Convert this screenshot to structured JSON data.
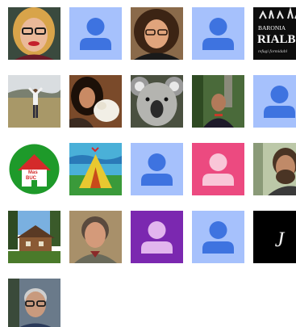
{
  "avatars": [
    {
      "name": "avatar-woman-glasses-red-lips",
      "kind": "photo"
    },
    {
      "name": "avatar-default-blue",
      "kind": "placeholder",
      "colors": {
        "bg": "#a6c1fc",
        "fg": "#3e73e0"
      }
    },
    {
      "name": "avatar-woman-curly-hair",
      "kind": "photo"
    },
    {
      "name": "avatar-default-blue",
      "kind": "placeholder",
      "colors": {
        "bg": "#a6c1fc",
        "fg": "#3e73e0"
      }
    },
    {
      "name": "avatar-baronia-rialb-logo",
      "kind": "logo",
      "text": {
        "line1": "BARONIA",
        "line2": "RIALB",
        "line3": "refugi formidabl"
      }
    },
    {
      "name": "avatar-person-arms-raised-field",
      "kind": "photo"
    },
    {
      "name": "avatar-woman-with-doll",
      "kind": "photo"
    },
    {
      "name": "avatar-koala",
      "kind": "photo"
    },
    {
      "name": "avatar-man-in-forest",
      "kind": "photo"
    },
    {
      "name": "avatar-default-blue",
      "kind": "placeholder",
      "colors": {
        "bg": "#a6c1fc",
        "fg": "#3e73e0"
      }
    },
    {
      "name": "avatar-mas-buc-logo",
      "kind": "logo",
      "text": {
        "line1": "Mas",
        "line2": "BUC"
      }
    },
    {
      "name": "avatar-tent-drawing",
      "kind": "illustration"
    },
    {
      "name": "avatar-default-blue",
      "kind": "placeholder",
      "colors": {
        "bg": "#a6c1fc",
        "fg": "#3e73e0"
      }
    },
    {
      "name": "avatar-default-pink",
      "kind": "placeholder",
      "colors": {
        "bg": "#ec4a80",
        "fg": "#f9c6d8"
      }
    },
    {
      "name": "avatar-bearded-man",
      "kind": "photo"
    },
    {
      "name": "avatar-wooden-house",
      "kind": "photo"
    },
    {
      "name": "avatar-woman-short-hair",
      "kind": "photo"
    },
    {
      "name": "avatar-default-purple",
      "kind": "placeholder",
      "colors": {
        "bg": "#7b28b0",
        "fg": "#e2b5ee"
      }
    },
    {
      "name": "avatar-default-blue",
      "kind": "placeholder",
      "colors": {
        "bg": "#a6c1fc",
        "fg": "#3e73e0"
      }
    },
    {
      "name": "avatar-letter-j-black",
      "kind": "logo",
      "text": {
        "letter": "J"
      }
    },
    {
      "name": "avatar-man-glasses-portrait",
      "kind": "photo"
    }
  ]
}
